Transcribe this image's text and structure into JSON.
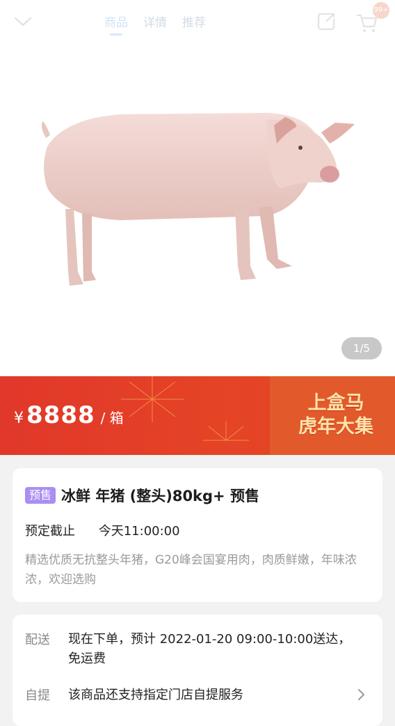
{
  "header": {
    "tabs": [
      {
        "label": "商品",
        "active": true
      },
      {
        "label": "详情",
        "active": false
      },
      {
        "label": "推荐",
        "active": false
      }
    ],
    "cart_badge": "99+"
  },
  "gallery": {
    "pager": "1/5"
  },
  "price_banner": {
    "currency": "¥",
    "amount": "8888",
    "unit": "/ 箱",
    "promo_line1": "上盒马",
    "promo_line2": "虎年大集",
    "colors": {
      "banner": "#e0382a",
      "promo_text": "#ffe3a8"
    }
  },
  "product": {
    "badge": "预售",
    "title": "冰鲜 年猪 (整头)80kg+ 预售",
    "deadline_label": "预定截止",
    "deadline_value": "今天11:00:00",
    "description": "精选优质无抗整头年猪，G20峰会国宴用肉，肉质鲜嫩，年味浓浓，欢迎选购"
  },
  "delivery": {
    "label": "配送",
    "text": "现在下单，预计 2022-01-20 09:00-10:00送达，免运费",
    "pickup_label": "自提",
    "pickup_text": "该商品还支持指定门店自提服务"
  },
  "icons": {
    "back": "chevron-down-icon",
    "share": "share-icon",
    "cart": "cart-icon",
    "more": "chevron-right-icon"
  }
}
